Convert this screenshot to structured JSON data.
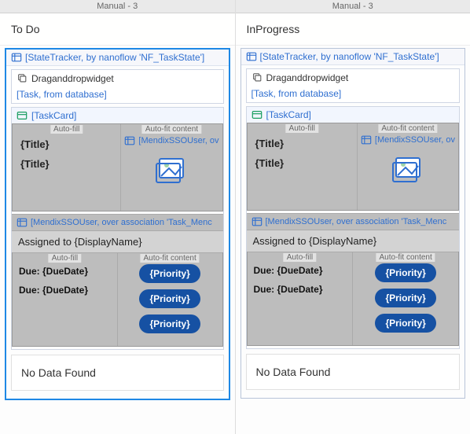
{
  "columns": [
    {
      "tab_label": "Manual - 3",
      "section_title": "To Do",
      "state_tracker_label": "[StateTracker, by nanoflow 'NF_TaskState']",
      "widget_name": "Draganddropwidget",
      "task_source": "[Task, from database]",
      "taskcard_label": "[TaskCard]",
      "cell_autofill": "Auto-fill",
      "cell_autofit": "Auto-fit content",
      "title_placeholder_1": "{Title}",
      "title_placeholder_2": "{Title}",
      "user_link": "[MendixSSOUser, ov",
      "assoc_label": "[MendixSSOUser, over association 'Task_Menc",
      "assigned_label": "Assigned to {DisplayName}",
      "due_label_1": "Due: {DueDate}",
      "due_label_2": "Due: {DueDate}",
      "priority_label": "{Priority}",
      "no_data": "No Data Found",
      "selected": true
    },
    {
      "tab_label": "Manual - 3",
      "section_title": "InProgress",
      "state_tracker_label": "[StateTracker, by nanoflow 'NF_TaskState']",
      "widget_name": "Draganddropwidget",
      "task_source": "[Task, from database]",
      "taskcard_label": "[TaskCard]",
      "cell_autofill": "Auto-fill",
      "cell_autofit": "Auto-fit content",
      "title_placeholder_1": "{Title}",
      "title_placeholder_2": "{Title}",
      "user_link": "[MendixSSOUser, ov",
      "assoc_label": "[MendixSSOUser, over association 'Task_Menc",
      "assigned_label": "Assigned to {DisplayName}",
      "due_label_1": "Due: {DueDate}",
      "due_label_2": "Due: {DueDate}",
      "priority_label": "{Priority}",
      "no_data": "No Data Found",
      "selected": false
    }
  ],
  "colors": {
    "accent": "#2f6fd0",
    "pill": "#1651a3"
  }
}
